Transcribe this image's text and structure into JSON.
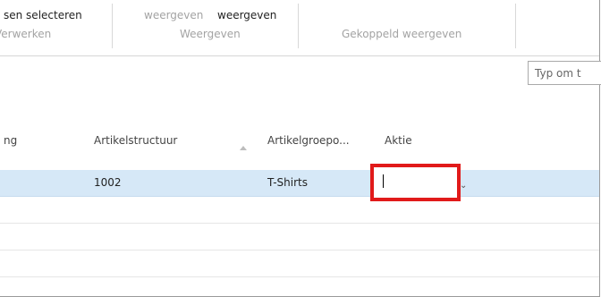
{
  "ribbon": {
    "items": {
      "selecteren": "sen  selecteren",
      "weergeven1": "weergeven",
      "weergeven2": "weergeven"
    },
    "groups": {
      "verwerken": "Verwerken",
      "weergeven": "Weergeven",
      "gekoppeld": "Gekoppeld weergeven"
    }
  },
  "search": {
    "placeholder": "Typ om t"
  },
  "table": {
    "columns": {
      "col0": "ng",
      "artikelstructuur": "Artikelstructuur",
      "artikelgroep": "Artikelgroepo...",
      "aktie": "Aktie"
    },
    "rows": [
      {
        "artikelstructuur": "1002",
        "artikelgroep": "T-Shirts",
        "aktie": ""
      }
    ]
  },
  "icons": {
    "sort": "sort-ascending-icon",
    "dropdown": "chevron-down-icon"
  },
  "colors": {
    "selected_row": "#d6e8f7",
    "highlight_box": "#e11a1a"
  }
}
